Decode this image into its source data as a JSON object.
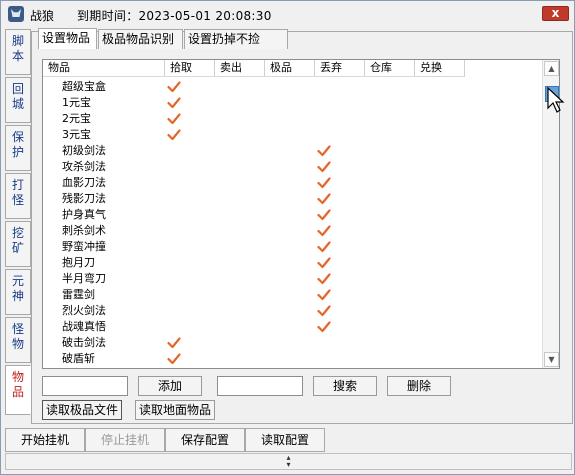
{
  "titlebar": {
    "title": "战狼",
    "expire_label": "到期时间：2023-05-01  20:08:30",
    "close_glyph": "x"
  },
  "side_tabs": [
    {
      "label": "脚本",
      "active": false
    },
    {
      "label": "回城",
      "active": false
    },
    {
      "label": "保护",
      "active": false
    },
    {
      "label": "打怪",
      "active": false
    },
    {
      "label": "挖矿",
      "active": false
    },
    {
      "label": "元神",
      "active": false
    },
    {
      "label": "怪物",
      "active": false
    },
    {
      "label": "物品",
      "active": true
    }
  ],
  "top_tabs": [
    {
      "label": "设置物品",
      "active": true
    },
    {
      "label": "极品物品识别",
      "active": false
    },
    {
      "label": "设置扔掉不捡",
      "active": false
    }
  ],
  "table": {
    "columns": [
      "物品",
      "拾取",
      "卖出",
      "极品",
      "丢弃",
      "仓库",
      "兑换"
    ],
    "rows": [
      {
        "name": "超级宝盒",
        "checked": [
          "拾取"
        ]
      },
      {
        "name": "1元宝",
        "checked": [
          "拾取"
        ]
      },
      {
        "name": "2元宝",
        "checked": [
          "拾取"
        ]
      },
      {
        "name": "3元宝",
        "checked": [
          "拾取"
        ]
      },
      {
        "name": "初级剑法",
        "checked": [
          "丢弃"
        ]
      },
      {
        "name": "攻杀剑法",
        "checked": [
          "丢弃"
        ]
      },
      {
        "name": "血影刀法",
        "checked": [
          "丢弃"
        ]
      },
      {
        "name": "残影刀法",
        "checked": [
          "丢弃"
        ]
      },
      {
        "name": "护身真气",
        "checked": [
          "丢弃"
        ]
      },
      {
        "name": "刺杀剑术",
        "checked": [
          "丢弃"
        ]
      },
      {
        "name": "野蛮冲撞",
        "checked": [
          "丢弃"
        ]
      },
      {
        "name": "抱月刀",
        "checked": [
          "丢弃"
        ]
      },
      {
        "name": "半月弯刀",
        "checked": [
          "丢弃"
        ]
      },
      {
        "name": "雷霆剑",
        "checked": [
          "丢弃"
        ]
      },
      {
        "name": "烈火剑法",
        "checked": [
          "丢弃"
        ]
      },
      {
        "name": "战魂真悟",
        "checked": [
          "丢弃"
        ]
      },
      {
        "name": "破击剑法",
        "checked": [
          "拾取"
        ]
      },
      {
        "name": "破盾斩",
        "checked": [
          "拾取"
        ]
      }
    ]
  },
  "controls": {
    "item_input_value": "",
    "add_label": "添加",
    "search_input_value": "",
    "search_label": "搜索",
    "delete_label": "删除",
    "read_rare_file_label": "读取极品文件",
    "read_ground_items_label": "读取地面物品"
  },
  "bottom_bar": {
    "start_label": "开始挂机",
    "stop_label": "停止挂机",
    "save_label": "保存配置",
    "load_label": "读取配置"
  },
  "colors": {
    "check": "#e8642a",
    "side_tab_text": "#1a3a8a",
    "active_side_tab_text": "#c0201a",
    "close_button": "#c0392b"
  },
  "icons": {
    "check": "check-icon",
    "scroll_up": "arrow-up-icon",
    "scroll_down": "arrow-down-icon",
    "grip": "resize-grip-icon"
  }
}
